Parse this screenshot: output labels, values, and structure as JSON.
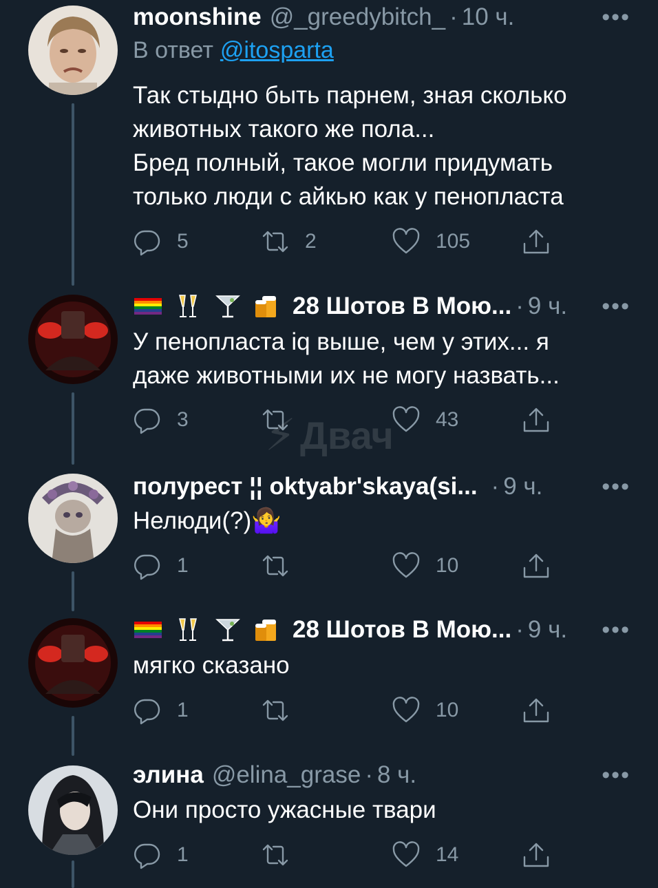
{
  "watermark": "Двач",
  "tweets": [
    {
      "name": "moonshine",
      "handle": "@_greedybitch_",
      "time": "10 ч.",
      "reply_prefix": "В ответ",
      "reply_mention": "@itosparta",
      "text": "Так стыдно быть парнем, зная сколько\nживотных такого же пола...\nБред полный, такое могли придумать\nтолько люди с айкью как у пенопласта",
      "counts": {
        "replies": "5",
        "retweets": "2",
        "likes": "105"
      },
      "avatar_color": "#cdbfb2"
    },
    {
      "name": "28 Шотов В Мою...",
      "time": "9 ч.",
      "text": "У пенопласта iq выше, чем у этих... я\nдаже животными их не могу назвать...",
      "counts": {
        "replies": "3",
        "retweets": "",
        "likes": "43"
      },
      "avatar_color": "#2a0a0a"
    },
    {
      "name": "полурест ¦¦ oktyabr'skaya(si...",
      "time": "9 ч.",
      "text": "Нелюди(?)🤷‍♀️",
      "counts": {
        "replies": "1",
        "retweets": "",
        "likes": "10"
      },
      "avatar_color": "#d9d6d0"
    },
    {
      "name": "28 Шотов В Мою...",
      "time": "9 ч.",
      "text": "мягко сказано",
      "counts": {
        "replies": "1",
        "retweets": "",
        "likes": "10"
      },
      "avatar_color": "#2a0a0a"
    },
    {
      "name": "элина",
      "handle": "@elina_grase",
      "time": "8 ч.",
      "text": "Они просто ужасные твари",
      "counts": {
        "replies": "1",
        "retweets": "",
        "likes": "14"
      },
      "avatar_color": "#3a4048"
    }
  ],
  "icons": [
    "reply-icon",
    "retweet-icon",
    "like-icon",
    "share-icon",
    "more-icon"
  ],
  "colors": {
    "background": "#15202b",
    "secondary_text": "#8899a6",
    "link": "#1da1f2"
  }
}
